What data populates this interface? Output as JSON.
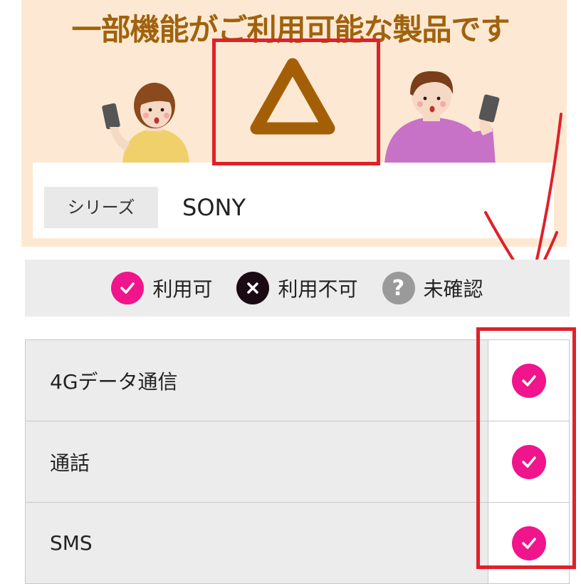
{
  "hero": {
    "title": "一部機能がご利用可能な製品です",
    "symbol": "triangle-icon"
  },
  "colors": {
    "hero_bg": "#fde9d3",
    "title": "#a0620e",
    "triangle": "#a45f06",
    "highlight_box": "#e0202a",
    "available": "#f0158c",
    "unavailable": "#1a0a14",
    "unknown": "#9a9a9a"
  },
  "series": {
    "label": "シリーズ",
    "value": "SONY"
  },
  "legend": {
    "items": [
      {
        "icon": "check-icon",
        "label": "利用可"
      },
      {
        "icon": "cross-icon",
        "label": "利用不可"
      },
      {
        "icon": "question-icon",
        "label": "未確認"
      }
    ]
  },
  "features": [
    {
      "name": "4Gデータ通信",
      "status": "check-icon"
    },
    {
      "name": "通話",
      "status": "check-icon"
    },
    {
      "name": "SMS",
      "status": "check-icon"
    }
  ]
}
